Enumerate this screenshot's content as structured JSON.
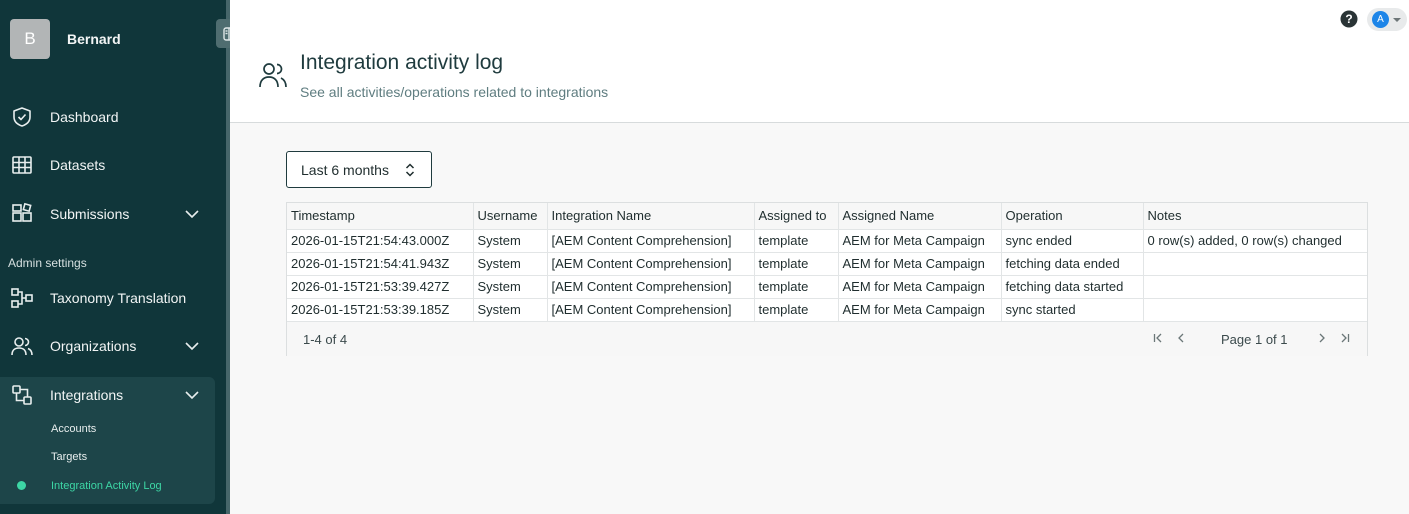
{
  "sidebar": {
    "avatar_initial": "B",
    "user_name": "Bernard",
    "nav": {
      "dashboard": "Dashboard",
      "datasets": "Datasets",
      "submissions": "Submissions",
      "admin_settings": "Admin settings",
      "taxonomy_translation": "Taxonomy Translation",
      "organizations": "Organizations",
      "integrations": "Integrations"
    },
    "integrations_sub": {
      "accounts": "Accounts",
      "targets": "Targets",
      "activity_log": "Integration Activity Log"
    }
  },
  "header": {
    "title": "Integration activity log",
    "subtitle": "See all activities/operations related to integrations",
    "user_initial": "A"
  },
  "filter": {
    "range_label": "Last 6 months"
  },
  "table": {
    "columns": [
      "Timestamp",
      "Username",
      "Integration Name",
      "Assigned to",
      "Assigned Name",
      "Operation",
      "Notes"
    ],
    "rows": [
      [
        "2026-01-15T21:54:43.000Z",
        "System",
        "[AEM Content Comprehension]",
        "template",
        "AEM for Meta Campaign",
        "sync ended",
        "0 row(s) added, 0 row(s) changed"
      ],
      [
        "2026-01-15T21:54:41.943Z",
        "System",
        "[AEM Content Comprehension]",
        "template",
        "AEM for Meta Campaign",
        "fetching data ended",
        ""
      ],
      [
        "2026-01-15T21:53:39.427Z",
        "System",
        "[AEM Content Comprehension]",
        "template",
        "AEM for Meta Campaign",
        "fetching data started",
        ""
      ],
      [
        "2026-01-15T21:53:39.185Z",
        "System",
        "[AEM Content Comprehension]",
        "template",
        "AEM for Meta Campaign",
        "sync started",
        ""
      ]
    ],
    "row_count": "1-4 of 4",
    "page_label": "Page 1 of 1"
  },
  "colors": {
    "sidebar_bg": "#10363a",
    "accent": "#3dd6a5",
    "user_dot": "#1d85e8"
  }
}
